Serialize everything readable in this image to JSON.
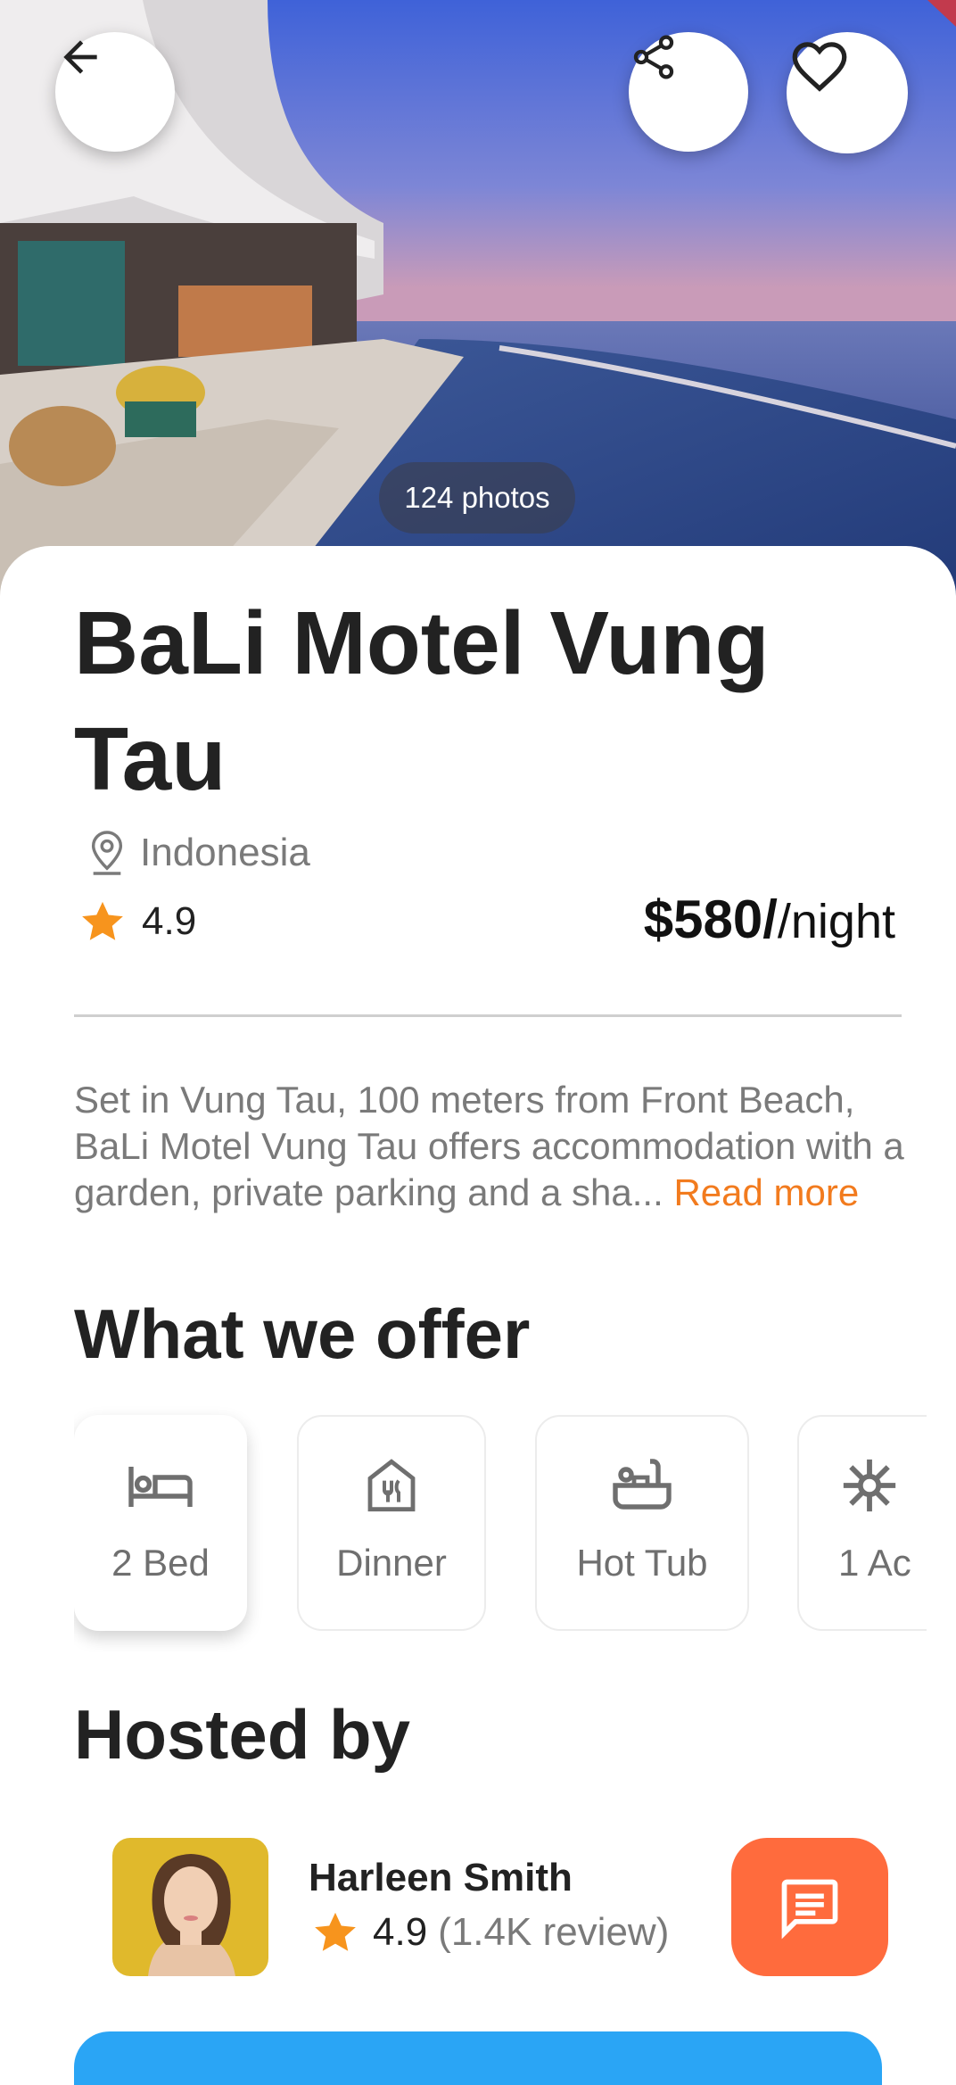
{
  "hero": {
    "photos_count_label": "124 photos",
    "back_icon": "arrow-left-icon",
    "share_icon": "share-icon",
    "favorite_icon": "heart-outline-icon"
  },
  "listing": {
    "title": "BaLi Motel Vung Tau",
    "location": "Indonesia",
    "rating": "4.9",
    "price": "$580",
    "price_unit": "/night",
    "description": "Set in Vung Tau, 100 meters from Front Beach, BaLi Motel Vung Tau offers accommodation with a garden, private parking and a sha...",
    "read_more_label": "Read more"
  },
  "offers": {
    "title": "What we offer",
    "items": [
      {
        "label": "2 Bed",
        "icon": "bed-icon"
      },
      {
        "label": "Dinner",
        "icon": "restaurant-icon"
      },
      {
        "label": "Hot Tub",
        "icon": "bathtub-icon"
      },
      {
        "label": "1 Ac",
        "icon": "snowflake-icon"
      }
    ]
  },
  "host": {
    "title": "Hosted by",
    "name": "Harleen Smith",
    "rating": "4.9",
    "reviews": "(1.4K review)",
    "chat_icon": "chat-icon"
  },
  "colors": {
    "accent_orange": "#f27b1e",
    "chat_button": "#ff6b3d",
    "star": "#f7941d",
    "cta_blue": "#2aa5f5"
  }
}
